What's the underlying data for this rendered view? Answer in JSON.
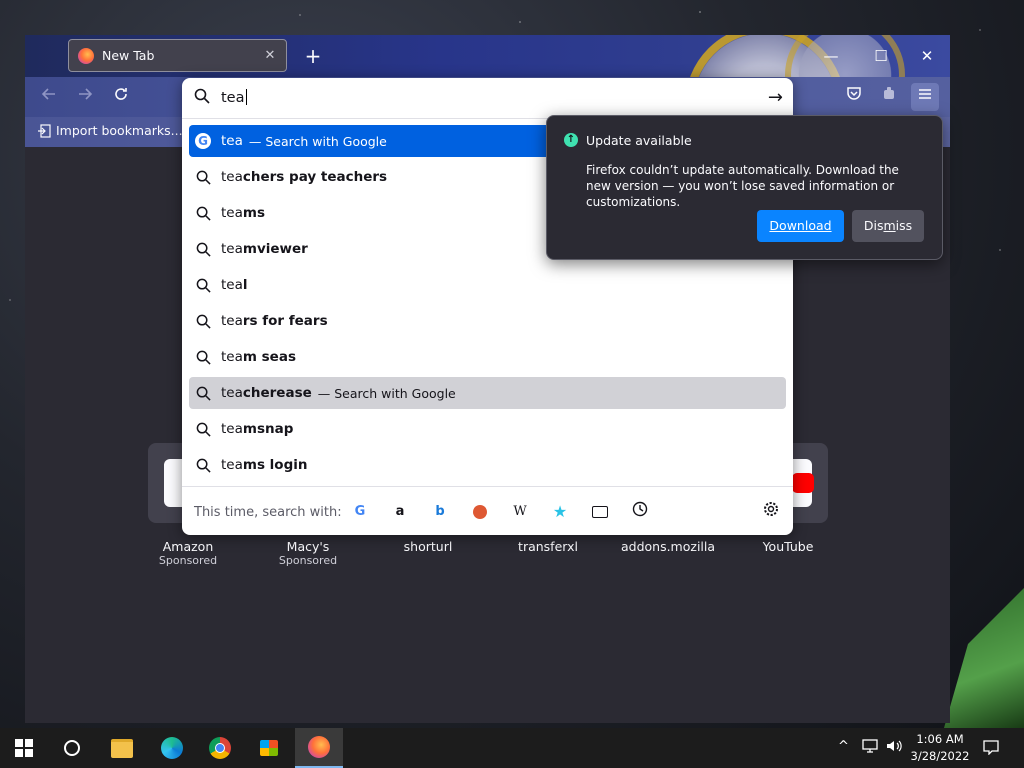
{
  "browser": {
    "tab_title": "New Tab",
    "tab_close": "✕",
    "new_tab": "+",
    "window_controls": {
      "minimize": "—",
      "maximize": "☐",
      "close": "✕"
    },
    "bookmarks": {
      "import_label": "Import bookmarks..."
    }
  },
  "urlbar": {
    "value": "tea",
    "go_icon": "→",
    "suggestions": [
      {
        "typed": "tea",
        "rest": "",
        "hint": "— Search with Google",
        "icon": "google-icon",
        "state": "selected"
      },
      {
        "typed": "tea",
        "rest": "chers pay teachers",
        "hint": "",
        "icon": "search-icon",
        "state": "normal"
      },
      {
        "typed": "tea",
        "rest": "ms",
        "hint": "",
        "icon": "search-icon",
        "state": "normal"
      },
      {
        "typed": "tea",
        "rest": "mviewer",
        "hint": "",
        "icon": "search-icon",
        "state": "normal"
      },
      {
        "typed": "tea",
        "rest": "l",
        "hint": "",
        "icon": "search-icon",
        "state": "normal"
      },
      {
        "typed": "tea",
        "rest": "rs for fears",
        "hint": "",
        "icon": "search-icon",
        "state": "normal"
      },
      {
        "typed": "tea",
        "rest": "m seas",
        "hint": "",
        "icon": "search-icon",
        "state": "normal"
      },
      {
        "typed": "tea",
        "rest": "cherease",
        "hint": "— Search with Google",
        "icon": "search-icon",
        "state": "hover"
      },
      {
        "typed": "tea",
        "rest": "msnap",
        "hint": "",
        "icon": "search-icon",
        "state": "normal"
      },
      {
        "typed": "tea",
        "rest": "ms login",
        "hint": "",
        "icon": "search-icon",
        "state": "normal"
      }
    ],
    "one_offs_label": "This time, search with:",
    "one_off_engines": [
      "google",
      "amazon",
      "bing",
      "duckduckgo",
      "wikipedia",
      "bookmarks",
      "tabs",
      "history"
    ]
  },
  "update_popup": {
    "title": "Update available",
    "message": "Firefox couldn’t update automatically. Download the new version — you won’t lose saved information or customizations.",
    "download_label": "Download",
    "dismiss_pre": "Dis",
    "dismiss_under": "m",
    "dismiss_post": "iss"
  },
  "shortcuts": [
    {
      "label": "Amazon",
      "sub": "Sponsored"
    },
    {
      "label": "Macy's",
      "sub": "Sponsored"
    },
    {
      "label": "shorturl",
      "sub": ""
    },
    {
      "label": "transferxl",
      "sub": ""
    },
    {
      "label": "addons.mozilla",
      "sub": ""
    },
    {
      "label": "YouTube",
      "sub": ""
    }
  ],
  "taskbar": {
    "time": "1:06 AM",
    "date": "3/28/2022"
  },
  "colors": {
    "accent": "#0061e0",
    "popup_button": "#0a84ff",
    "update_icon": "#3fe1b0"
  }
}
